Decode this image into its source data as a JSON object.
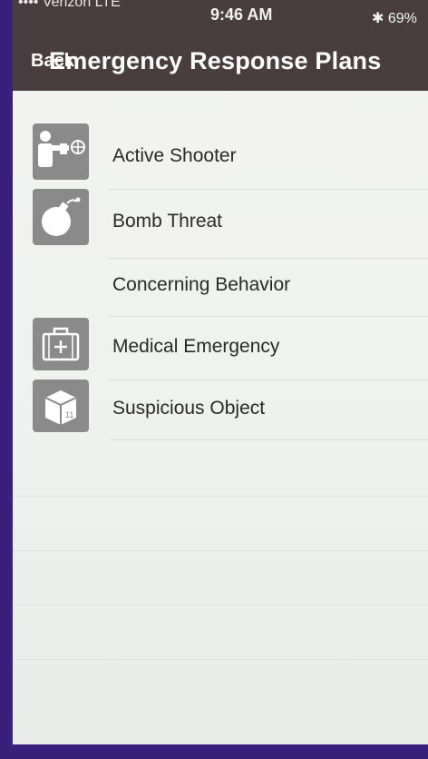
{
  "status_bar": {
    "carrier": "•••• Verizon  LTE",
    "time": "9:46 AM",
    "battery": "✱ 69%"
  },
  "nav": {
    "back_label": "Back",
    "title": "Emergency Response Plans"
  },
  "rows": [
    {
      "label": "Active Shooter",
      "icon": "shooter-icon"
    },
    {
      "label": "Bomb Threat",
      "icon": "bomb-icon"
    },
    {
      "label": "Concerning Behavior",
      "icon": ""
    },
    {
      "label": "Medical Emergency",
      "icon": "medical-kit-icon"
    },
    {
      "label": "Suspicious Object",
      "icon": "package-icon"
    }
  ],
  "colors": {
    "nav_background": "#4a3d3f",
    "icon_background": "#8a8a8a",
    "frame": "#3b1f7d"
  }
}
